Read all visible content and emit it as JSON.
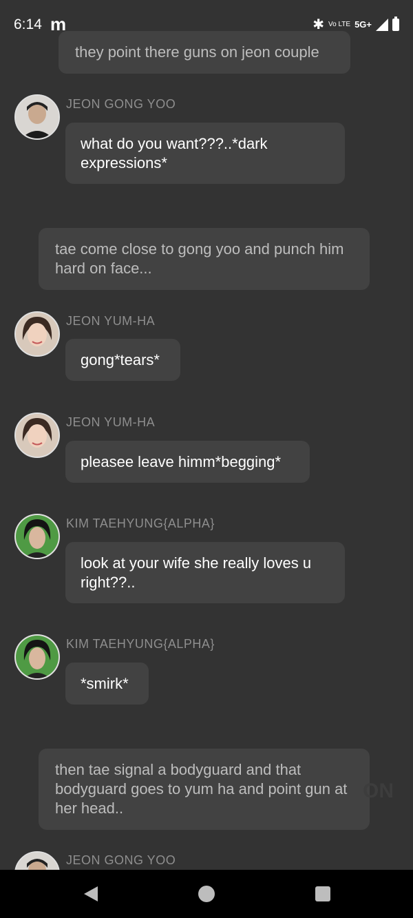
{
  "status_bar": {
    "time": "6:14",
    "app_icon": "m",
    "bluetooth_icon": "bluetooth-icon",
    "volte_label": "Vo LTE",
    "network": "5G+",
    "signal_icon": "signal-icon",
    "battery_icon": "battery-icon"
  },
  "messages": [
    {
      "kind": "narration",
      "text": "they point there guns on jeon couple"
    },
    {
      "kind": "character",
      "speaker": "JEON GONG YOO",
      "text": "what do you want???..*dark expressions*"
    },
    {
      "kind": "narration",
      "text": "tae come close to gong yoo and punch him hard on face..."
    },
    {
      "kind": "character",
      "speaker": "JEON YUM-HA",
      "text": "gong*tears*"
    },
    {
      "kind": "character",
      "speaker": "JEON YUM-HA",
      "text": "pleasee leave himm*begging*"
    },
    {
      "kind": "character",
      "speaker": "KIM TAEHYUNG{ALPHA}",
      "text": "look at your wife she really loves u right??.."
    },
    {
      "kind": "character",
      "speaker": "KIM TAEHYUNG{ALPHA}",
      "text": "*smirk*"
    },
    {
      "kind": "narration",
      "text": "then tae signal a bodyguard and that bodyguard goes to yum ha and point gun at her head.."
    },
    {
      "kind": "character",
      "speaker": "JEON GONG YOO",
      "text": ""
    }
  ],
  "watermark": "ON",
  "nav": {
    "back": "back-icon",
    "home": "home-icon",
    "recents": "recents-icon"
  }
}
